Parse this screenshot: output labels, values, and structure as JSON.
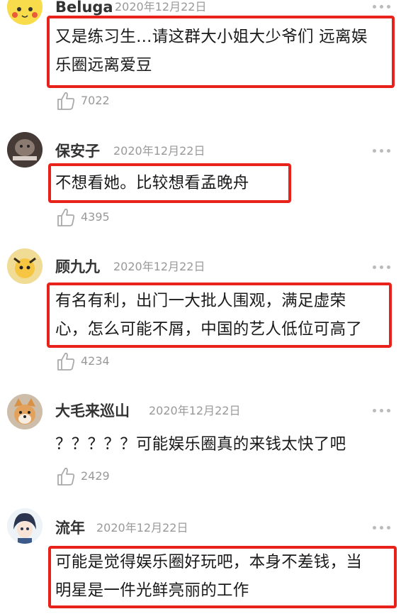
{
  "comments": [
    {
      "username": "Beluga",
      "date": "2020年12月22日",
      "text_lines": [
        "又是练习生…请这群大小姐大少爷们 远离娱",
        "乐圈远离爱豆"
      ],
      "likes": "7022",
      "avatar_icon": "pikachu-avatar-icon",
      "highlighted": true
    },
    {
      "username": "保安子",
      "date": "2020年12月22日",
      "text_lines": [
        "不想看她。比较想看孟晚舟"
      ],
      "likes": "4395",
      "avatar_icon": "meme-avatar-icon",
      "highlighted": true
    },
    {
      "username": "顾九九",
      "date": "2020年12月22日",
      "text_lines": [
        "有名有利，出门一大批人围观，满足虚荣",
        "心，怎么可能不屑，中国的艺人低位可高了"
      ],
      "likes": "4234",
      "avatar_icon": "cartoon-avatar-icon",
      "highlighted": true
    },
    {
      "username": "大毛来巡山",
      "date": "2020年12月22日",
      "text_lines": [
        "？？？？？可能娱乐圈真的来钱太快了吧"
      ],
      "likes": "2429",
      "avatar_icon": "shiba-dog-avatar-icon",
      "highlighted": false
    },
    {
      "username": "流年",
      "date": "2020年12月22日",
      "text_lines": [
        "可能是觉得娱乐圈好玩吧，本身不差钱，当",
        "明星是一件光鲜亮丽的工作"
      ],
      "likes": "",
      "avatar_icon": "anime-avatar-icon",
      "highlighted": true
    }
  ],
  "colors": {
    "highlight": "#e8221b",
    "meta_gray": "#999999",
    "text": "#1a1a1a"
  }
}
